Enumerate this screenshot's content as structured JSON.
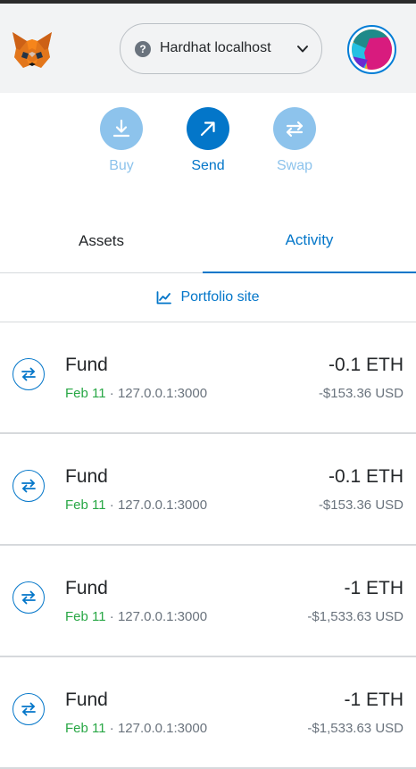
{
  "header": {
    "network_label": "Hardhat localhost",
    "network_help_glyph": "?",
    "icons": {
      "logo": "metamask-fox-icon",
      "chevron": "chevron-down-icon",
      "avatar": "account-avatar"
    }
  },
  "actions": [
    {
      "label": "Buy",
      "icon": "download-icon",
      "enabled": false
    },
    {
      "label": "Send",
      "icon": "arrow-up-right-icon",
      "enabled": true
    },
    {
      "label": "Swap",
      "icon": "swap-icon",
      "enabled": false
    }
  ],
  "tabs": [
    {
      "label": "Assets",
      "active": false
    },
    {
      "label": "Activity",
      "active": true
    }
  ],
  "portfolio": {
    "label": "Portfolio site",
    "icon": "chart-line-icon"
  },
  "transactions": [
    {
      "title": "Fund",
      "date": "Feb 11",
      "separator": " · ",
      "origin": "127.0.0.1:3000",
      "amount": "-0.1 ETH",
      "fiat": "-$153.36 USD"
    },
    {
      "title": "Fund",
      "date": "Feb 11",
      "separator": " · ",
      "origin": "127.0.0.1:3000",
      "amount": "-0.1 ETH",
      "fiat": "-$153.36 USD"
    },
    {
      "title": "Fund",
      "date": "Feb 11",
      "separator": " · ",
      "origin": "127.0.0.1:3000",
      "amount": "-1 ETH",
      "fiat": "-$1,533.63 USD"
    },
    {
      "title": "Fund",
      "date": "Feb 11",
      "separator": " · ",
      "origin": "127.0.0.1:3000",
      "amount": "-1 ETH",
      "fiat": "-$1,533.63 USD"
    }
  ],
  "colors": {
    "accent": "#0376c9",
    "accent_disabled": "#8dc3ec",
    "date_green": "#28a745",
    "header_bg": "#f2f3f4"
  }
}
